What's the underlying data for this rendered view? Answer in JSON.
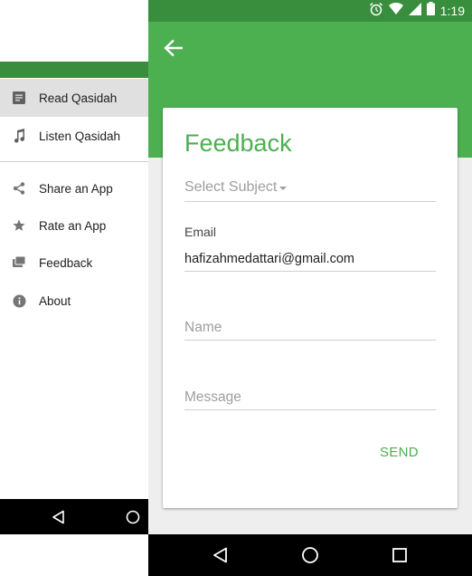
{
  "drawer": {
    "items": [
      {
        "label": "Read Qasidah",
        "icon": "document-icon",
        "active": true
      },
      {
        "label": "Listen Qasidah",
        "icon": "music-note-icon",
        "active": false
      },
      {
        "label": "Share an App",
        "icon": "share-icon",
        "active": false
      },
      {
        "label": "Rate an App",
        "icon": "star-icon",
        "active": false
      },
      {
        "label": "Feedback",
        "icon": "feedback-icon",
        "active": false
      },
      {
        "label": "About",
        "icon": "info-icon",
        "active": false
      }
    ]
  },
  "status_bar": {
    "time": "1:19",
    "icons": [
      "alarm-icon",
      "wifi-icon",
      "signal-icon",
      "battery-icon"
    ]
  },
  "app_bar": {
    "back_icon": "arrow-back-icon"
  },
  "form": {
    "title": "Feedback",
    "subject_placeholder": "Select Subject",
    "email_label": "Email",
    "email_value": "hafizahmedattari@gmail.com",
    "name_placeholder": "Name",
    "message_placeholder": "Message",
    "send_label": "SEND"
  },
  "colors": {
    "primary": "#4caf50",
    "primary_dark": "#388e3c",
    "background": "#eeeeee"
  },
  "nav_bar": {
    "buttons": [
      "back-nav-icon",
      "home-nav-icon",
      "recents-nav-icon"
    ]
  }
}
